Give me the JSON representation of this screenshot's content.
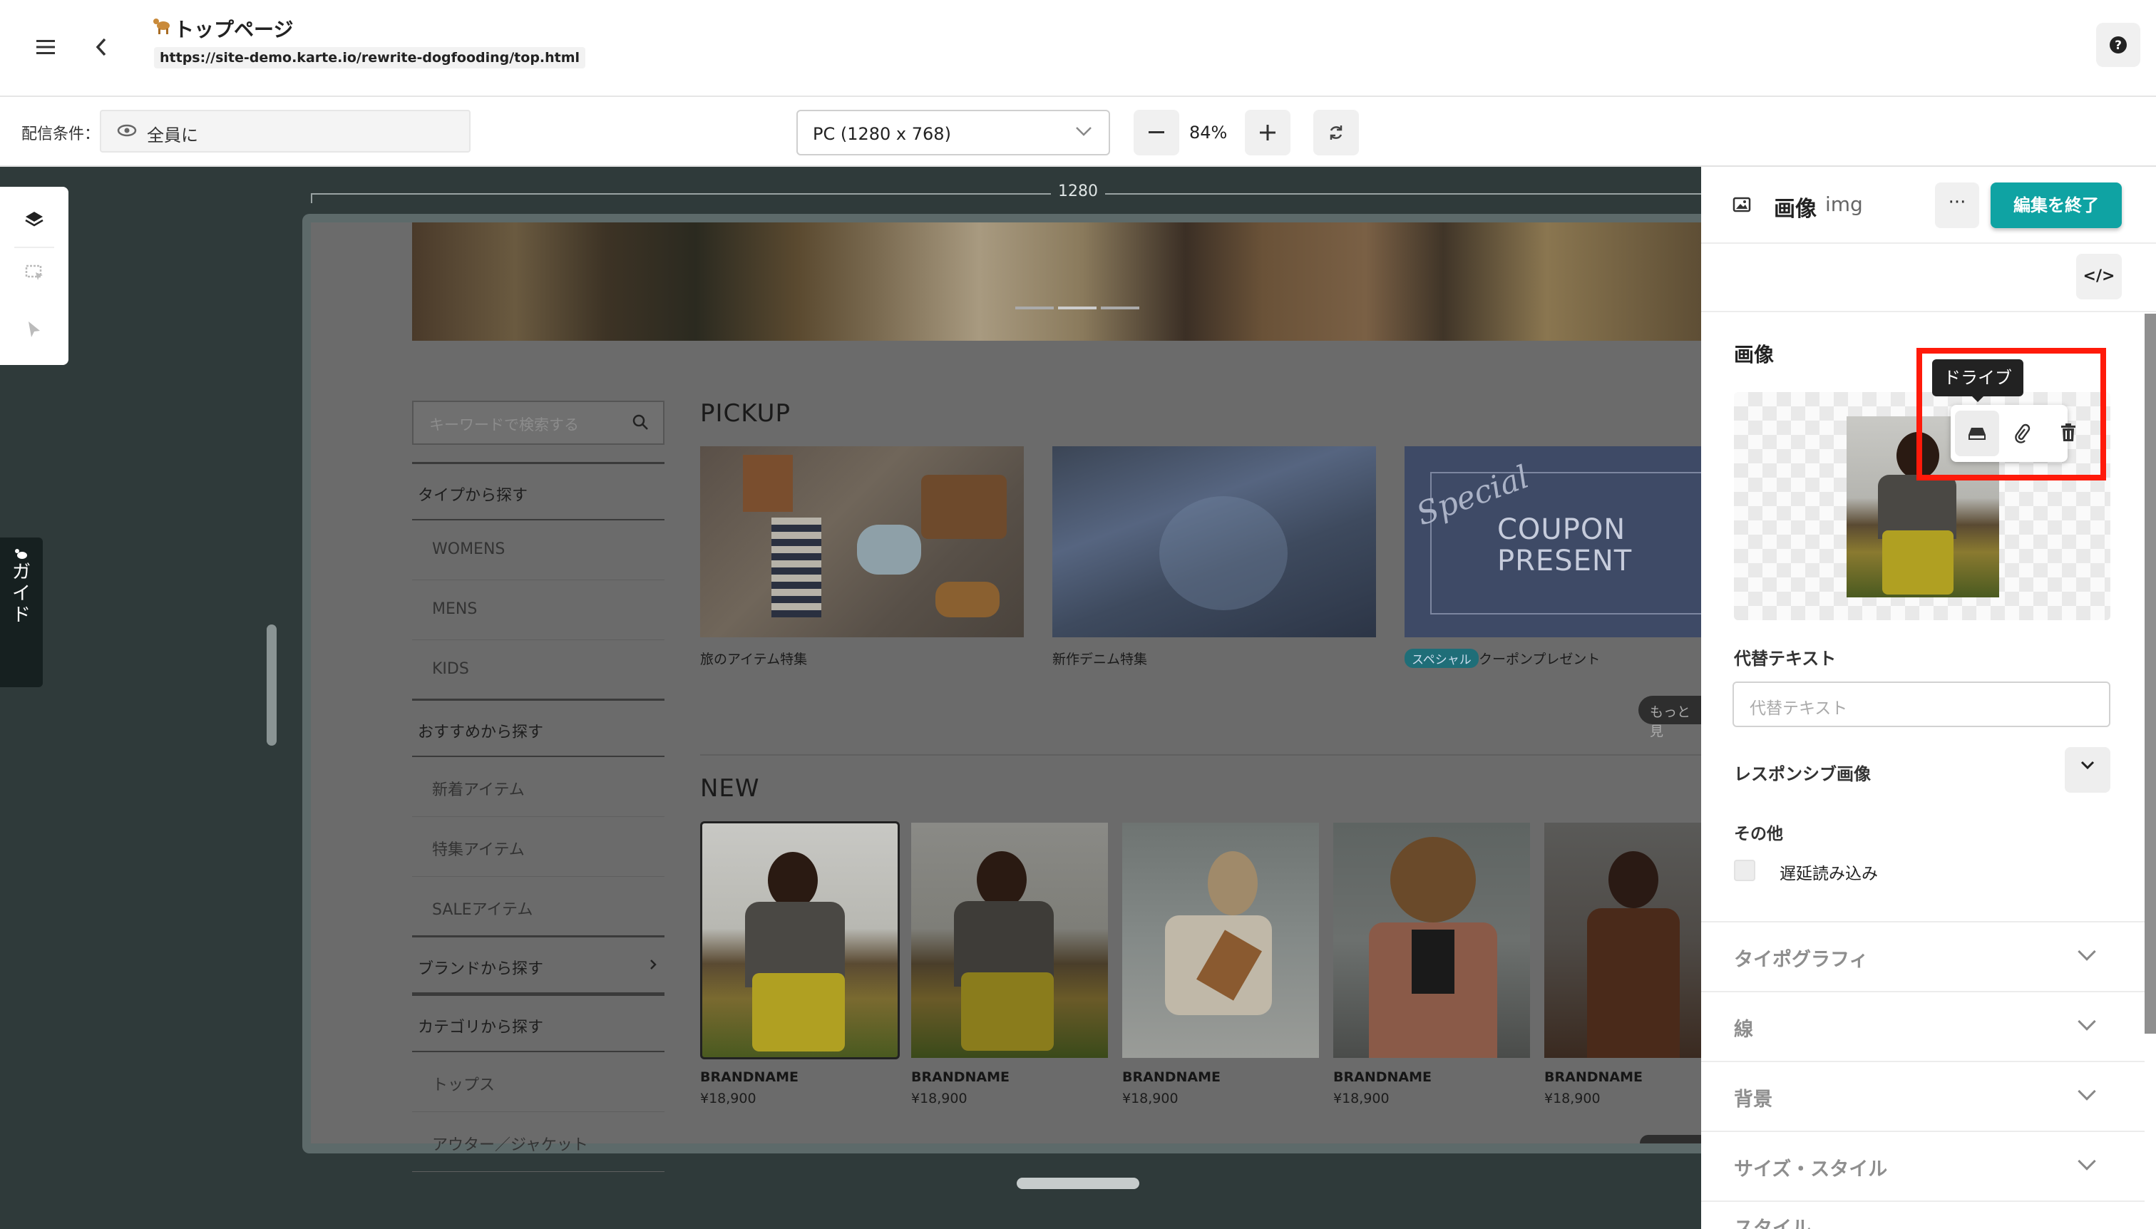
{
  "header": {
    "page_icon": "camel-icon",
    "title": "トップページ",
    "url": "https://site-demo.karte.io/rewrite-dogfooding/top.html"
  },
  "toolbar": {
    "condition_label": "配信条件：",
    "condition_value": "全員に",
    "device": "PC (1280 x 768)",
    "zoom": "84%"
  },
  "canvas": {
    "ruler_width": "1280",
    "guide_label": [
      "ガ",
      "イ",
      "ド"
    ],
    "site": {
      "search_placeholder": "キーワードで検索する",
      "nav": [
        {
          "type": "heading",
          "label": "タイプから探す"
        },
        {
          "type": "item",
          "label": "WOMENS"
        },
        {
          "type": "item",
          "label": "MENS"
        },
        {
          "type": "item",
          "label": "KIDS"
        },
        {
          "type": "heading",
          "label": "おすすめから探す"
        },
        {
          "type": "item",
          "label": "新着アイテム"
        },
        {
          "type": "item",
          "label": "特集アイテム"
        },
        {
          "type": "item",
          "label": "SALEアイテム"
        },
        {
          "type": "heading",
          "label": "ブランドから探す"
        },
        {
          "type": "heading",
          "label": "カテゴリから探す"
        },
        {
          "type": "item",
          "label": "トップス"
        },
        {
          "type": "item",
          "label": "アウター／ジャケット"
        }
      ],
      "pickup_title": "PICKUP",
      "pickup": [
        {
          "caption": "旅のアイテム特集"
        },
        {
          "caption": "新作デニム特集"
        },
        {
          "badge": "スペシャル",
          "caption": "クーポンプレゼント",
          "banner_script": "Special",
          "banner_line1": "COUPON",
          "banner_line2": "PRESENT"
        }
      ],
      "more_label": "もっと見",
      "new_title": "NEW",
      "new_items": [
        {
          "brand": "BRANDNAME",
          "price": "¥18,900"
        },
        {
          "brand": "BRANDNAME",
          "price": "¥18,900"
        },
        {
          "brand": "BRANDNAME",
          "price": "¥18,900"
        },
        {
          "brand": "BRANDNAME",
          "price": "¥18,900"
        },
        {
          "brand": "BRANDNAME",
          "price": "¥18,900"
        }
      ]
    }
  },
  "panel": {
    "element_name": "画像",
    "element_tag": "img",
    "more_label": "···",
    "end_edit_label": "編集を終了",
    "code_label": "</>",
    "image_heading": "画像",
    "tooltip": "ドライブ",
    "alt_label": "代替テキスト",
    "alt_placeholder": "代替テキスト",
    "responsive_label": "レスポンシブ画像",
    "other_label": "その他",
    "lazy_label": "遅延読み込み",
    "accordions": [
      "タイポグラフィ",
      "線",
      "背景",
      "サイズ・スタイル",
      "スタイル"
    ]
  },
  "colors": {
    "accent": "#0fa3a3",
    "highlight": "#ff1a0a",
    "workspace_bg": "#2f3a3a"
  }
}
